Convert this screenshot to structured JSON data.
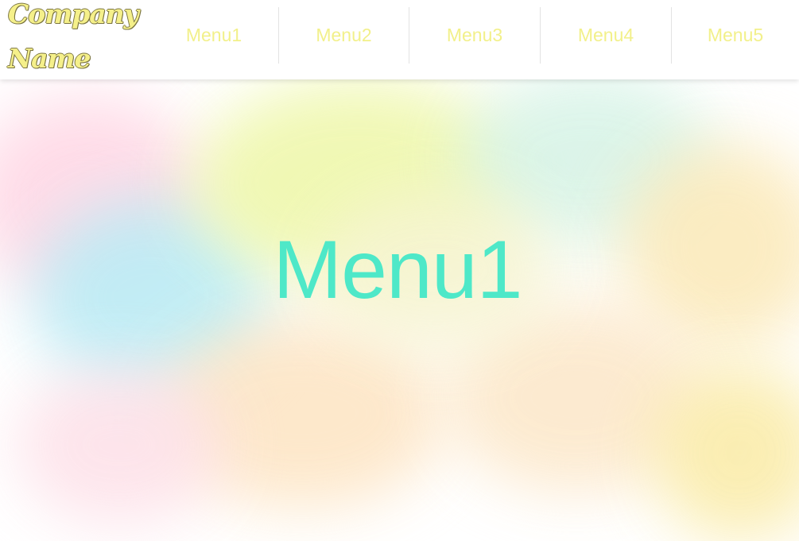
{
  "header": {
    "logo_text": "Company Name",
    "nav": [
      {
        "label": "Menu1"
      },
      {
        "label": "Menu2"
      },
      {
        "label": "Menu3"
      },
      {
        "label": "Menu4"
      },
      {
        "label": "Menu5"
      }
    ]
  },
  "hero": {
    "title": "Menu1"
  },
  "colors": {
    "logo": "#f5f08a",
    "nav_text": "#f2f08a",
    "hero_title": "#4ee8c8"
  }
}
